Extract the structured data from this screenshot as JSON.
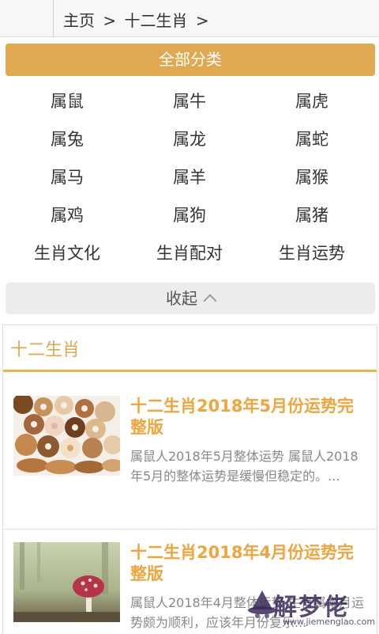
{
  "breadcrumb": {
    "home": "主页",
    "sep1": ">",
    "current": "十二生肖",
    "sep2": ">"
  },
  "all_categories": "全部分类",
  "categories": [
    [
      "属鼠",
      "属牛",
      "属虎"
    ],
    [
      "属兔",
      "属龙",
      "属蛇"
    ],
    [
      "属马",
      "属羊",
      "属猴"
    ],
    [
      "属鸡",
      "属狗",
      "属猪"
    ],
    [
      "生肖文化",
      "生肖配对",
      "生肖运势"
    ]
  ],
  "collapse_label": "收起",
  "section_title": "十二生肖",
  "articles": [
    {
      "title": "十二生肖2018年5月份运势完整版",
      "excerpt": "属鼠人2018年5月整体运势 属鼠人2018年5月的整体运势是缓慢但稳定的。..."
    },
    {
      "title": "十二生肖2018年4月份运势完整版",
      "excerpt": "属鼠人2018年4月整体运势 生肖属本月运势颇为顺利，应该年月份复乐..."
    }
  ],
  "watermark": {
    "name": "解梦佬",
    "url": "www.jiemenglao.com"
  },
  "colors": {
    "accent": "#e0a84f",
    "title": "#f0a53c"
  }
}
